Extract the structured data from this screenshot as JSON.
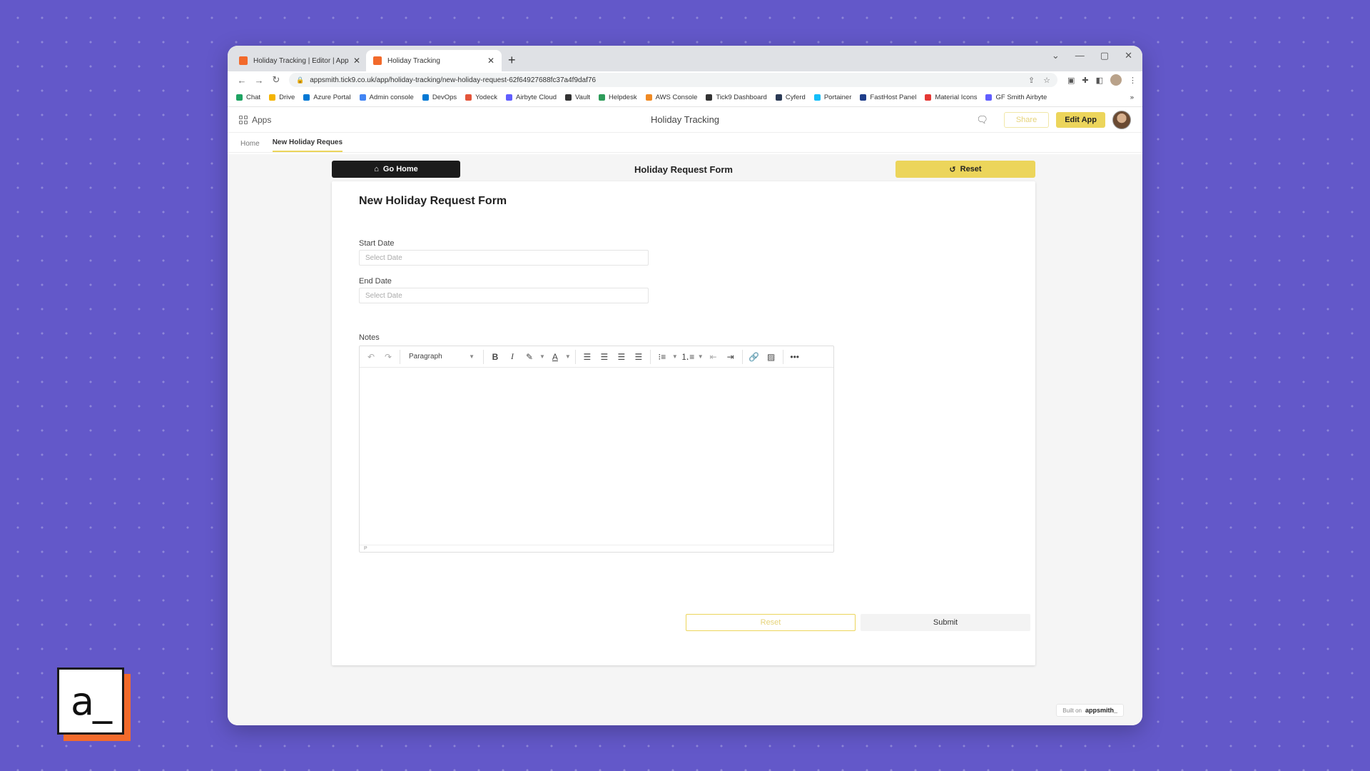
{
  "browser": {
    "tabs": [
      {
        "title": "Holiday Tracking | Editor | Appsm",
        "active": false
      },
      {
        "title": "Holiday Tracking",
        "active": true
      }
    ],
    "url": "appsmith.tick9.co.uk/app/holiday-tracking/new-holiday-request-62f64927688fc37a4f9daf76",
    "bookmarks": [
      {
        "label": "Chat",
        "color": "#1ea362"
      },
      {
        "label": "Drive",
        "color": "#f4b400"
      },
      {
        "label": "Azure Portal",
        "color": "#0078d4"
      },
      {
        "label": "Admin console",
        "color": "#4285f4"
      },
      {
        "label": "DevOps",
        "color": "#0078d4"
      },
      {
        "label": "Yodeck",
        "color": "#e4553a"
      },
      {
        "label": "Airbyte Cloud",
        "color": "#615eff"
      },
      {
        "label": "Vault",
        "color": "#333333"
      },
      {
        "label": "Helpdesk",
        "color": "#2e9c5a"
      },
      {
        "label": "AWS Console",
        "color": "#f08a24"
      },
      {
        "label": "Tick9 Dashboard",
        "color": "#333333"
      },
      {
        "label": "Cyferd",
        "color": "#2b3a55"
      },
      {
        "label": "Portainer",
        "color": "#13bef9"
      },
      {
        "label": "FastHost Panel",
        "color": "#1f3e8a"
      },
      {
        "label": "Material Icons",
        "color": "#e53935"
      },
      {
        "label": "GF Smith Airbyte",
        "color": "#615eff"
      }
    ]
  },
  "app": {
    "apps_label": "Apps",
    "title": "Holiday Tracking",
    "share_label": "Share",
    "edit_label": "Edit App",
    "pages": [
      {
        "label": "Home",
        "active": false
      },
      {
        "label": "New Holiday Reques",
        "active": true
      }
    ]
  },
  "form": {
    "go_home_label": "Go Home",
    "header_title": "Holiday Request Form",
    "top_reset_label": "Reset",
    "title": "New Holiday Request Form",
    "start_date_label": "Start Date",
    "start_date_placeholder": "Select Date",
    "end_date_label": "End Date",
    "end_date_placeholder": "Select Date",
    "notes_label": "Notes",
    "paragraph_select": "Paragraph",
    "statusbar_text": "P",
    "reset_label": "Reset",
    "submit_label": "Submit"
  },
  "footer": {
    "built_on": "Built on",
    "brand": "appsmith_"
  },
  "logo_text": "a_",
  "colors": {
    "accent": "#ecd55b",
    "background": "#6358c9",
    "logo_shadow": "#f26a2b"
  }
}
